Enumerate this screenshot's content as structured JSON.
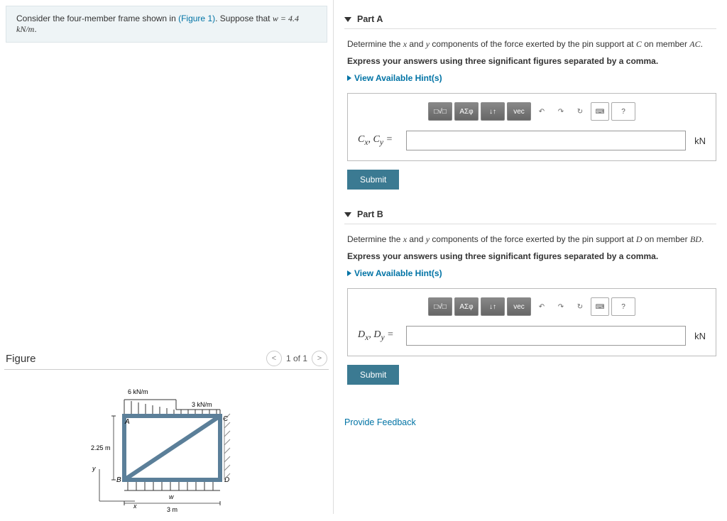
{
  "intro": {
    "prefix": "Consider the four-member frame shown in ",
    "figure_link": "(Figure 1)",
    "suffix": ". Suppose that ",
    "equation": "w = 4.4 kN/m",
    "period": "."
  },
  "figure": {
    "title": "Figure",
    "page_current": "1",
    "page_sep": " of ",
    "page_total": "1",
    "labels": {
      "topload": "6 kN/m",
      "rightload": "3 kN/m",
      "height": "2.25 m",
      "width": "3 m",
      "A": "A",
      "B": "B",
      "C": "C",
      "D": "D",
      "w": "w",
      "x": "x",
      "y": "y"
    }
  },
  "partA": {
    "title": "Part A",
    "desc_prefix": "Determine the ",
    "x": "x",
    "and": " and ",
    "y": "y",
    "desc_mid": " components of the force exerted by the pin support at ",
    "C": "C",
    "on": " on member ",
    "AC": "AC",
    "period": ".",
    "bold": "Express your answers using three significant figures separated by a comma.",
    "hints": "View Available Hint(s)",
    "var_label": "Cₓ, C_y =",
    "var_html": "C<sub>x</sub>, C<sub>y</sub> =",
    "unit": "kN",
    "submit": "Submit",
    "value": ""
  },
  "partB": {
    "title": "Part B",
    "desc_prefix": "Determine the ",
    "x": "x",
    "and": " and ",
    "y": "y",
    "desc_mid": " components of the force exerted by the pin support at ",
    "D": "D",
    "on": " on member ",
    "BD": "BD",
    "period": ".",
    "bold": "Express your answers using three significant figures separated by a comma.",
    "hints": "View Available Hint(s)",
    "var_html": "D<sub>x</sub>, D<sub>y</sub> =",
    "unit": "kN",
    "submit": "Submit",
    "value": ""
  },
  "toolbar": {
    "templates": "□√□",
    "greek": "ΑΣφ",
    "subscript": "↓↑",
    "vec": "vec",
    "undo": "↶",
    "redo": "↷",
    "reset": "↻",
    "keyboard": "⌨",
    "help": "?"
  },
  "feedback": "Provide Feedback"
}
